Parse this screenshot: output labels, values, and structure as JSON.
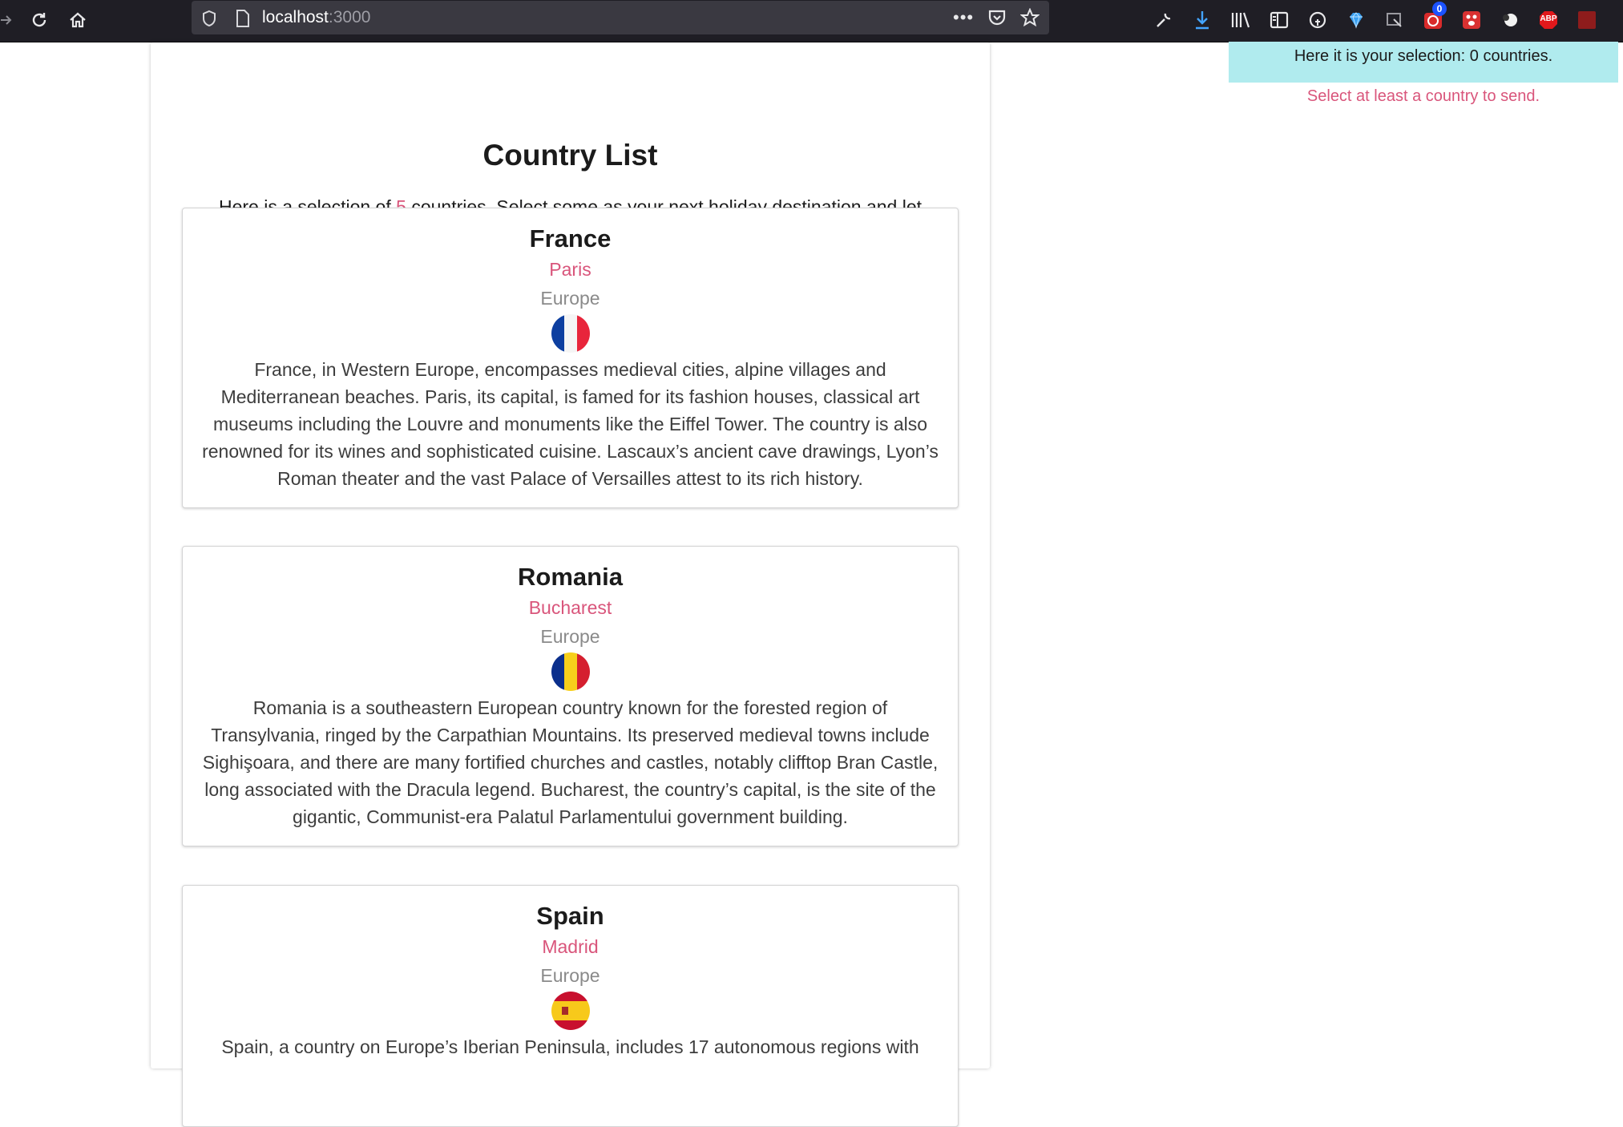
{
  "browser": {
    "url_host": "localhost",
    "url_port": ":3000",
    "badge_count": "0",
    "abp_label": "ABP"
  },
  "page": {
    "title": "Country List",
    "intro_before": "Here is a selection of ",
    "intro_count": "5",
    "intro_after": " countries. Select some as your next holiday destination and let your best friend know about it!"
  },
  "countries": [
    {
      "name": "France",
      "capital": "Paris",
      "region": "Europe",
      "flag_icon": "flag-france-icon",
      "description": "France, in Western Europe, encompasses medieval cities, alpine villages and Mediterranean beaches. Paris, its capital, is famed for its fashion houses, classical art museums including the Louvre and monuments like the Eiffel Tower. The country is also renowned for its wines and sophisticated cuisine. Lascaux’s ancient cave drawings, Lyon’s Roman theater and the vast Palace of Versailles attest to its rich history."
    },
    {
      "name": "Romania",
      "capital": "Bucharest",
      "region": "Europe",
      "flag_icon": "flag-romania-icon",
      "description": "Romania is a southeastern European country known for the forested region of Transylvania, ringed by the Carpathian Mountains. Its preserved medieval towns include Sighişoara, and there are many fortified churches and castles, notably clifftop Bran Castle, long associated with the Dracula legend. Bucharest, the country’s capital, is the site of the gigantic, Communist-era Palatul Parlamentului government building."
    },
    {
      "name": "Spain",
      "capital": "Madrid",
      "region": "Europe",
      "flag_icon": "flag-spain-icon",
      "description": "Spain, a country on Europe’s Iberian Peninsula, includes 17 autonomous regions with"
    }
  ],
  "selection": {
    "summary": "Here it is your selection: 0 countries.",
    "hint": "Select at least a country to send."
  },
  "colors": {
    "accent": "#d9557b",
    "selection_bg": "#b0ebee",
    "toolbar_bg": "#1f1e25"
  }
}
